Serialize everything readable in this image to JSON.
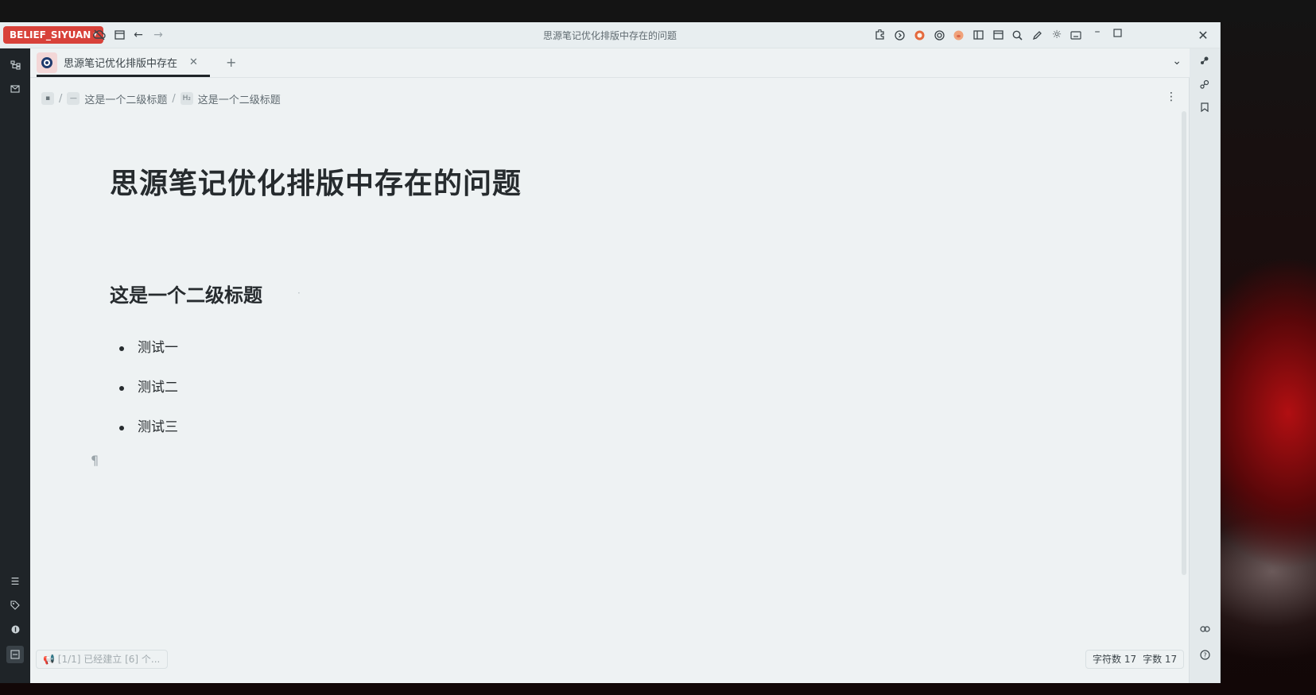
{
  "window": {
    "title": "思源笔记优化排版中存在的问题",
    "workspace": "BELIEF_SIYUAN"
  },
  "toolbar": {
    "left_icons": [
      "sync-cloud-icon",
      "calendar-icon",
      "back-icon",
      "forward-icon"
    ],
    "right_icons": [
      "plugin-icon",
      "arrow-circle-icon",
      "avatar-plugin-icon",
      "target-icon",
      "pig-plugin-icon",
      "layout-icon",
      "calendar-icon",
      "search-icon",
      "pen-icon",
      "sun-icon",
      "keyboard-icon"
    ],
    "window_controls": [
      "minimize",
      "maximize",
      "close"
    ]
  },
  "tabs": [
    {
      "label": "思源笔记优化排版中存在",
      "active": true
    }
  ],
  "breadcrumb": [
    {
      "icon": "doc",
      "label": ""
    },
    {
      "icon": "—",
      "label": "这是一个二级标题"
    },
    {
      "icon": "H₂",
      "label": "这是一个二级标题"
    }
  ],
  "document": {
    "title": "思源笔记优化排版中存在的问题",
    "heading2": "这是一个二级标题",
    "list": [
      "测试一",
      "测试二",
      "测试三"
    ],
    "pilcrow": "¶"
  },
  "status": {
    "left_message": "[1/1] 已经建立 [6] 个...",
    "char_count": "字符数 17",
    "word_count": "字数 17"
  },
  "colors": {
    "workspace_accent": "#d8423a",
    "left_dock_bg": "#1f2428",
    "editor_bg": "#eef2f3"
  }
}
